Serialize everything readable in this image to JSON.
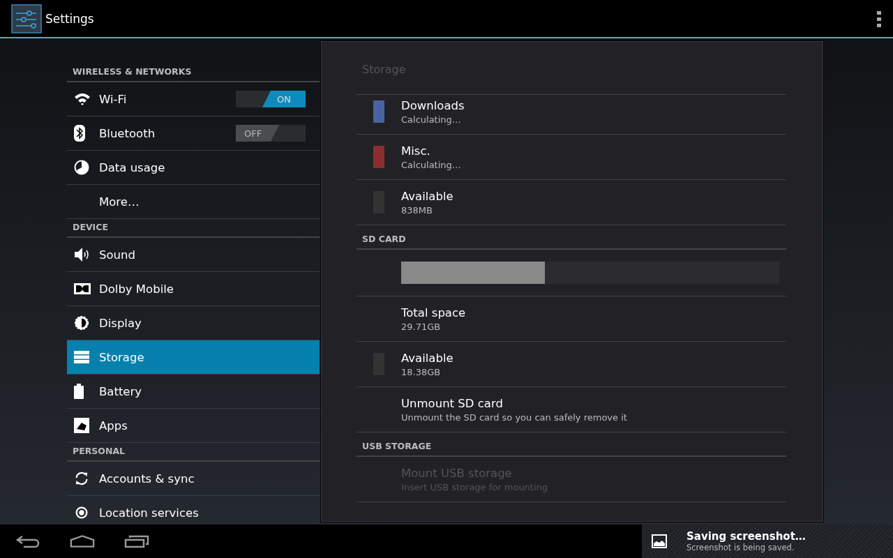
{
  "action_bar": {
    "title": "Settings"
  },
  "sidebar": {
    "sections": [
      {
        "header": "WIRELESS & NETWORKS",
        "items": [
          {
            "label": "Wi-Fi",
            "kind": "toggle",
            "toggle": {
              "on": true,
              "label": "ON"
            },
            "selected": false
          },
          {
            "label": "Bluetooth",
            "kind": "toggle",
            "toggle": {
              "on": false,
              "label": "OFF"
            },
            "selected": false
          },
          {
            "label": "Data usage",
            "kind": "plain",
            "selected": false
          },
          {
            "label": "More…",
            "kind": "plain",
            "selected": false
          }
        ]
      },
      {
        "header": "DEVICE",
        "items": [
          {
            "label": "Sound",
            "kind": "plain",
            "selected": false
          },
          {
            "label": "Dolby Mobile",
            "kind": "plain",
            "selected": false
          },
          {
            "label": "Display",
            "kind": "plain",
            "selected": false
          },
          {
            "label": "Storage",
            "kind": "plain",
            "selected": true
          },
          {
            "label": "Battery",
            "kind": "plain",
            "selected": false
          },
          {
            "label": "Apps",
            "kind": "plain",
            "selected": false
          }
        ]
      },
      {
        "header": "PERSONAL",
        "items": [
          {
            "label": "Accounts & sync",
            "kind": "plain",
            "selected": false
          },
          {
            "label": "Location services",
            "kind": "plain",
            "selected": false
          }
        ]
      }
    ]
  },
  "detail": {
    "title": "Storage",
    "rows": [
      {
        "kind": "storage",
        "title": "Downloads",
        "summary": "Calculating…",
        "color": "#4a62a0"
      },
      {
        "kind": "storage",
        "title": "Misc.",
        "summary": "Calculating…",
        "color": "#8a2f30"
      },
      {
        "kind": "storage",
        "title": "Available",
        "summary": "838MB",
        "color": "#333333"
      },
      {
        "kind": "header",
        "title": "SD CARD"
      },
      {
        "kind": "bar",
        "level": 0.38
      },
      {
        "kind": "item",
        "title": "Total space",
        "summary": "29.71GB",
        "disabled": false
      },
      {
        "kind": "storage",
        "title": "Available",
        "summary": "18.38GB",
        "color": "#333333"
      },
      {
        "kind": "item",
        "title": "Unmount SD card",
        "summary": "Unmount the SD card so you can safely remove it",
        "disabled": false
      },
      {
        "kind": "header",
        "title": "USB STORAGE"
      },
      {
        "kind": "item",
        "title": "Mount USB storage",
        "summary": "Insert USB storage for mounting",
        "disabled": true
      }
    ]
  },
  "notification": {
    "title": "Saving screenshot…",
    "text": "Screenshot is being saved."
  }
}
